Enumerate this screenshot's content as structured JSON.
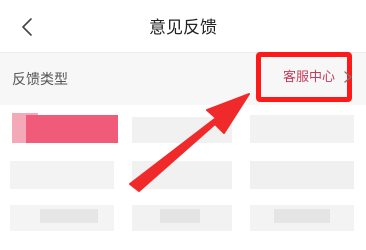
{
  "nav": {
    "title": "意见反馈",
    "back_icon": "chevron-left-icon"
  },
  "section": {
    "label": "反馈类型",
    "customer_service": "客服中心",
    "chevron_icon": "chevron-right-icon"
  },
  "colors": {
    "accent": "#c73a5a",
    "highlight_border": "#ff1a1a",
    "arrow": "#f02a2a",
    "selected_tile": "#ef5b79"
  },
  "annotation": {
    "type": "arrow",
    "target": "customer_service"
  }
}
